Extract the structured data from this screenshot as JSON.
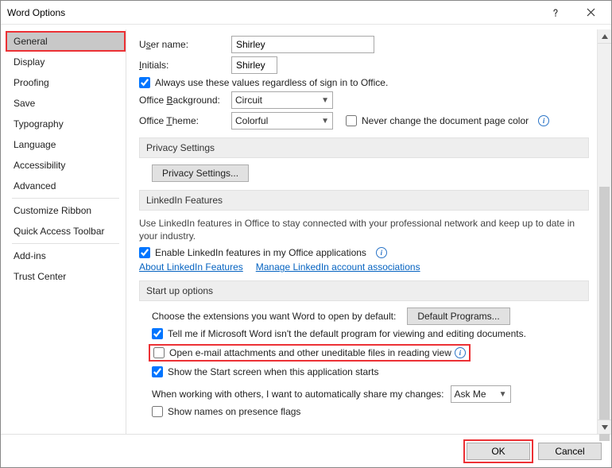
{
  "title": "Word Options",
  "sidebar": {
    "items": [
      {
        "label": "General",
        "selected": true
      },
      {
        "label": "Display"
      },
      {
        "label": "Proofing"
      },
      {
        "label": "Save"
      },
      {
        "label": "Typography"
      },
      {
        "label": "Language"
      },
      {
        "label": "Accessibility"
      },
      {
        "label": "Advanced"
      }
    ],
    "items2": [
      {
        "label": "Customize Ribbon"
      },
      {
        "label": "Quick Access Toolbar"
      }
    ],
    "items3": [
      {
        "label": "Add-ins"
      },
      {
        "label": "Trust Center"
      }
    ]
  },
  "general": {
    "username_label_pre": "U",
    "username_label_ul": "s",
    "username_label_post": "er name:",
    "username_value": "Shirley",
    "initials_label_ul": "I",
    "initials_label_post": "nitials:",
    "initials_value": "Shirley",
    "always_use_pre": "A",
    "always_use_ul": "l",
    "always_use_post": "ways use these values regardless of sign in to Office.",
    "office_bg_pre": "Office ",
    "office_bg_ul": "B",
    "office_bg_post": "ackground:",
    "office_bg_value": "Circuit",
    "office_theme_pre": "Office ",
    "office_theme_ul": "T",
    "office_theme_post": "heme:",
    "office_theme_value": "Colorful",
    "never_change_color": "Never change the document page color"
  },
  "privacy": {
    "heading": "Privacy Settings",
    "button": "Privacy Settings..."
  },
  "linkedin": {
    "heading": "LinkedIn Features",
    "desc": "Use LinkedIn features in Office to stay connected with your professional network and keep up to date in your industry.",
    "enable": "Enable LinkedIn features in my Office applications",
    "link1": "About LinkedIn Features",
    "link2": "Manage LinkedIn account associations"
  },
  "startup": {
    "heading": "Start up options",
    "choose_ext": "Choose the extensions you want Word to open by default:",
    "default_programs_btn": "Default Programs...",
    "tell_me": "Tell me if Microsoft Word isn't the default program for viewing and editing documents.",
    "open_email_ul": "O",
    "open_email_post": "pen e-mail attachments and other uneditable files in reading view",
    "show_start_pre": "S",
    "show_start_ul": "h",
    "show_start_post": "ow the Start screen when this application starts",
    "share_changes": "When working with others, I want to automatically share my changes:",
    "share_value": "Ask Me",
    "show_names": "Show names on presence flags"
  },
  "footer": {
    "ok": "OK",
    "cancel": "Cancel"
  }
}
